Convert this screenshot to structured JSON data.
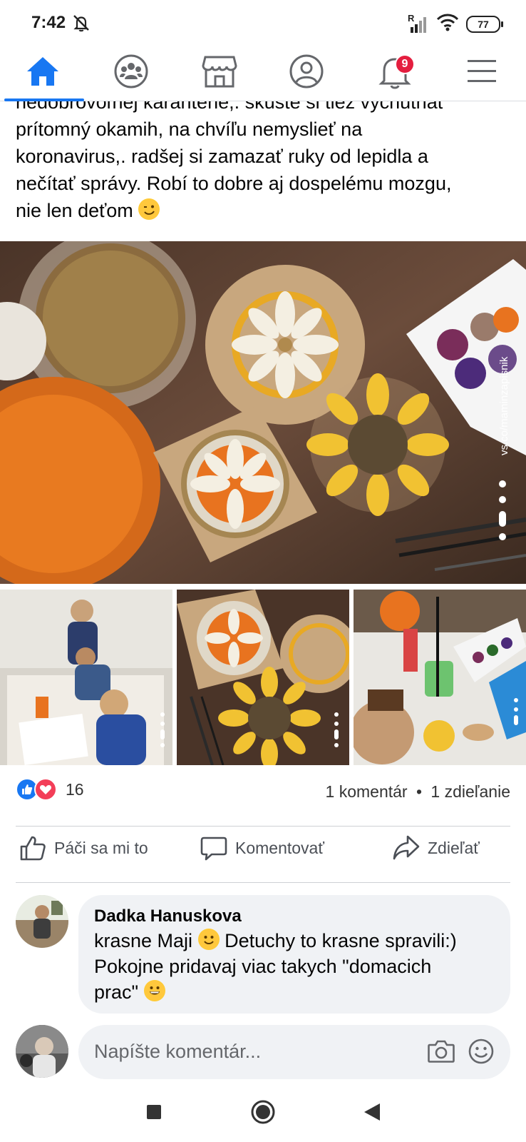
{
  "status": {
    "time": "7:42",
    "battery": "77",
    "signal_label": "R"
  },
  "navbar": {
    "items": [
      {
        "name": "home",
        "icon": "home-icon",
        "active": true
      },
      {
        "name": "groups",
        "icon": "groups-icon"
      },
      {
        "name": "marketplace",
        "icon": "marketplace-icon"
      },
      {
        "name": "profile",
        "icon": "profile-icon"
      },
      {
        "name": "notifications",
        "icon": "bell-icon",
        "badge": "9"
      },
      {
        "name": "menu",
        "icon": "hamburger-menu-icon"
      }
    ],
    "accent": "#1877f2",
    "badge_color": "#e41e3f"
  },
  "post": {
    "text_lines": [
      "nedobrovoľnej karanténe,. skúste si tiež vychutnať",
      "prítomný okamih, na chvíľu nemyslieť na",
      "koronavirus,. radšej si zamazať ruky od lepidla a",
      "nečítať správy. Robí to dobre aj dospelému mozgu,",
      "nie len deťom"
    ],
    "watermark": "vs.co/maminzapisnik"
  },
  "reactions": {
    "count": "16",
    "comments": "1 komentár",
    "shares": "1 zdieľanie",
    "separator": "•"
  },
  "actions": {
    "like": "Páči sa mi to",
    "comment": "Komentovať",
    "share": "Zdieľať"
  },
  "comment": {
    "author": "Dadka Hanuskova",
    "line1": "krasne Maji",
    "line1b": "Detuchy to krasne spravili:)",
    "line2": "Pokojne pridavaj viac takych \"domacich",
    "line3": "prac\""
  },
  "compose": {
    "placeholder": "Napíšte komentár..."
  }
}
